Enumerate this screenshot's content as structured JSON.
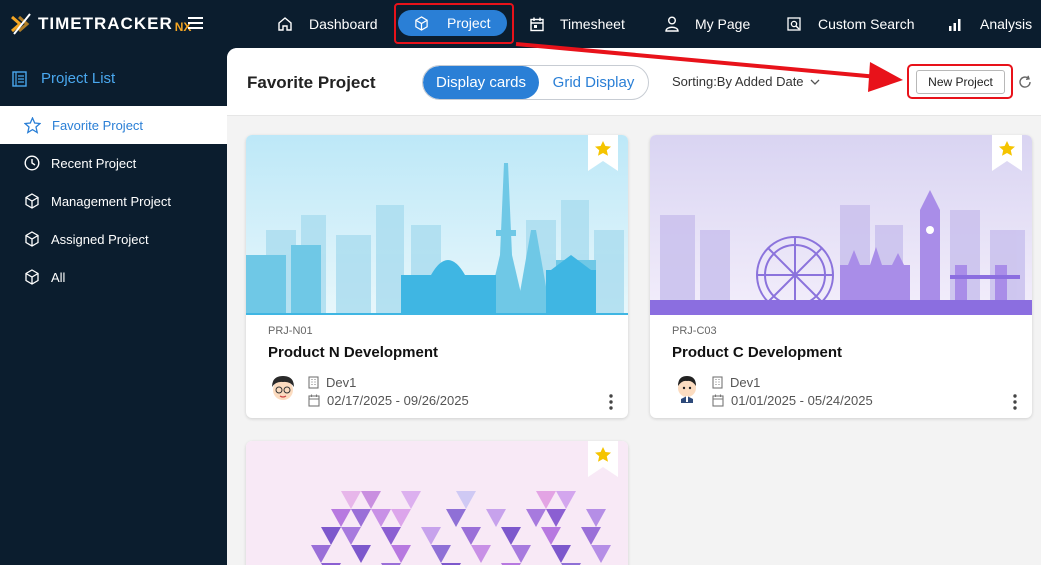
{
  "app": {
    "logo_text": "TIMETRACKER",
    "logo_suffix": "NX"
  },
  "nav": [
    {
      "label": "Dashboard",
      "icon": "home-icon"
    },
    {
      "label": "Project",
      "icon": "cube-icon",
      "active": true
    },
    {
      "label": "Timesheet",
      "icon": "calendar-icon"
    },
    {
      "label": "My Page",
      "icon": "user-icon"
    },
    {
      "label": "Custom Search",
      "icon": "search-doc-icon"
    },
    {
      "label": "Analysis",
      "icon": "bar-chart-icon"
    }
  ],
  "sidebar": {
    "title": "Project List",
    "items": [
      {
        "label": "Favorite Project",
        "icon": "star-icon",
        "active": true
      },
      {
        "label": "Recent Project",
        "icon": "clock-icon"
      },
      {
        "label": "Management Project",
        "icon": "cube-icon"
      },
      {
        "label": "Assigned Project",
        "icon": "cube-icon"
      },
      {
        "label": "All",
        "icon": "cube-icon"
      }
    ]
  },
  "header": {
    "title": "Favorite Project",
    "view_cards": "Display cards",
    "view_grid": "Grid Display",
    "sorting": "Sorting:By Added Date",
    "new_project": "New Project"
  },
  "cards": [
    {
      "code": "PRJ-N01",
      "name": "Product N Development",
      "dept": "Dev1",
      "period": "02/17/2025 - 09/26/2025",
      "favorite": true
    },
    {
      "code": "PRJ-C03",
      "name": "Product C Development",
      "dept": "Dev1",
      "period": "01/01/2025 - 05/24/2025",
      "favorite": true
    },
    {
      "code": "",
      "name": "",
      "dept": "",
      "period": "",
      "favorite": true
    }
  ],
  "colors": {
    "navy": "#0b1d2e",
    "accent": "#2a7fd6",
    "highlight_red": "#e8121a",
    "star": "#f5c400"
  }
}
